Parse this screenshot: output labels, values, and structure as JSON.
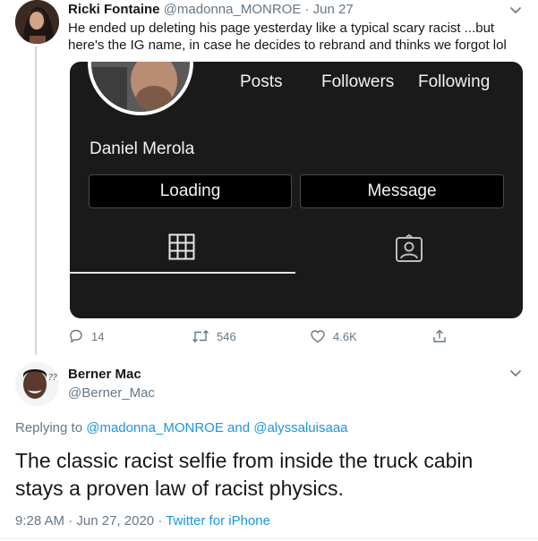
{
  "tweet1": {
    "author_name": "Ricki Fontaine",
    "author_handle": "@madonna_MONROE",
    "separator": "·",
    "date": "Jun 27",
    "text": "He ended up deleting his page yesterday like a typical scary racist ...but here's the IG name, in case he decides to rebrand and thinks we forgot lol",
    "embedded_profile": {
      "stats": [
        "Posts",
        "Followers",
        "Following"
      ],
      "name": "Daniel Merola",
      "buttons": [
        "Loading",
        "Message"
      ],
      "tabs": [
        "grid-icon",
        "tagged-icon"
      ]
    },
    "actions": {
      "replies": "14",
      "retweets": "546",
      "likes": "4.6K"
    }
  },
  "tweet2": {
    "author_name": "Berner Mac",
    "author_handle": "@Berner_Mac",
    "replying_prefix": "Replying to",
    "replying_to_1": "@madonna_MONROE",
    "replying_and": "and",
    "replying_to_2": "@alyssaluisaaa",
    "text": "The classic racist selfie from inside the truck cabin stays a proven law of racist physics.",
    "time": "9:28 AM",
    "separator": "·",
    "date": "Jun 27, 2020",
    "source": "Twitter for iPhone"
  },
  "colors": {
    "link": "#1b95e0",
    "muted": "#657786",
    "text": "#14171a",
    "card_bg": "#1a1a1a"
  }
}
